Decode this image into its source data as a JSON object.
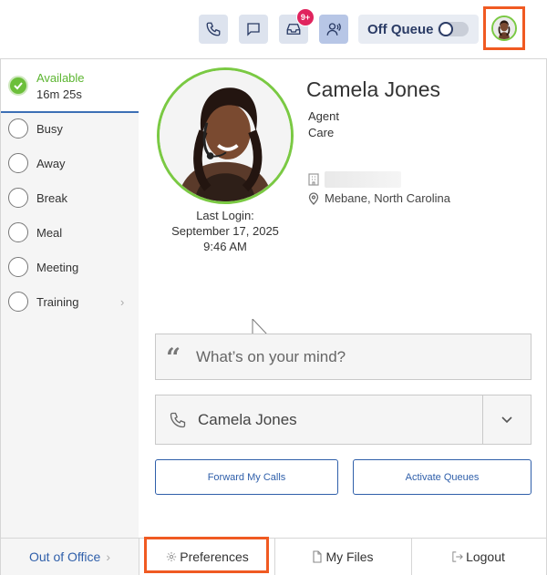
{
  "topbar": {
    "notification_count": "9+",
    "queue_label": "Off Queue",
    "queue_on": false
  },
  "status": {
    "active_label": "Available",
    "active_time": "16m 25s",
    "items": [
      {
        "label": "Busy"
      },
      {
        "label": "Away"
      },
      {
        "label": "Break"
      },
      {
        "label": "Meal"
      },
      {
        "label": "Meeting"
      },
      {
        "label": "Training"
      }
    ]
  },
  "profile": {
    "name": "Camela Jones",
    "role": "Agent",
    "department": "Care",
    "location": "Mebane, North Carolina",
    "last_login_label": "Last Login:",
    "last_login_date": "September 17, 2025",
    "last_login_time": "9:46 AM"
  },
  "composer": {
    "placeholder": "What’s on your mind?"
  },
  "phone": {
    "selected": "Camela Jones"
  },
  "actions": {
    "forward": "Forward My Calls",
    "activate": "Activate Queues"
  },
  "footer": {
    "out_of_office": "Out of Office",
    "preferences": "Preferences",
    "my_files": "My Files",
    "logout": "Logout"
  },
  "colors": {
    "accent": "#2f5faa",
    "available": "#6cbf3a",
    "highlight": "#f05a22"
  }
}
